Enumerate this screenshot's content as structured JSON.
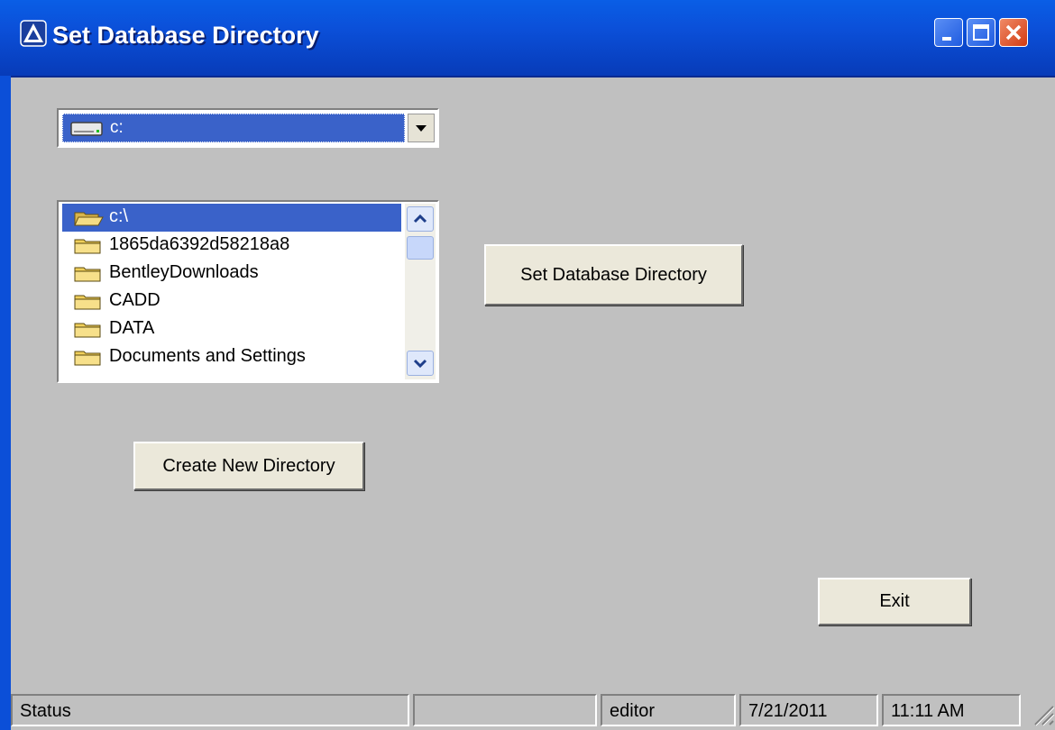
{
  "window": {
    "title": "Set Database Directory",
    "controls": [
      "minimize-icon",
      "maximize-icon",
      "close-icon"
    ],
    "title_bar_color": "#0b4fd8"
  },
  "drive_select": {
    "value": "c:",
    "icon": "drive-icon"
  },
  "directory_list": {
    "items": [
      {
        "label": "c:\\",
        "icon": "open-folder-icon",
        "selected": true
      },
      {
        "label": "1865da6392d58218a8",
        "icon": "folder-icon",
        "selected": false
      },
      {
        "label": "BentleyDownloads",
        "icon": "folder-icon",
        "selected": false
      },
      {
        "label": "CADD",
        "icon": "folder-icon",
        "selected": false
      },
      {
        "label": "DATA",
        "icon": "folder-icon",
        "selected": false
      },
      {
        "label": "Documents and Settings",
        "icon": "folder-icon",
        "selected": false
      }
    ]
  },
  "buttons": {
    "set_database_directory": "Set Database Directory",
    "create_new_directory": "Create New Directory",
    "exit": "Exit"
  },
  "statusbar": {
    "status": "Status",
    "panel2": "",
    "user": "editor",
    "date": "7/21/2011",
    "time": "11:11 AM"
  },
  "colors": {
    "selection": "#3a62c9",
    "dialog_bg": "#c0c0c0",
    "button_face": "#ebe8da",
    "close_button": "#d23b12"
  }
}
